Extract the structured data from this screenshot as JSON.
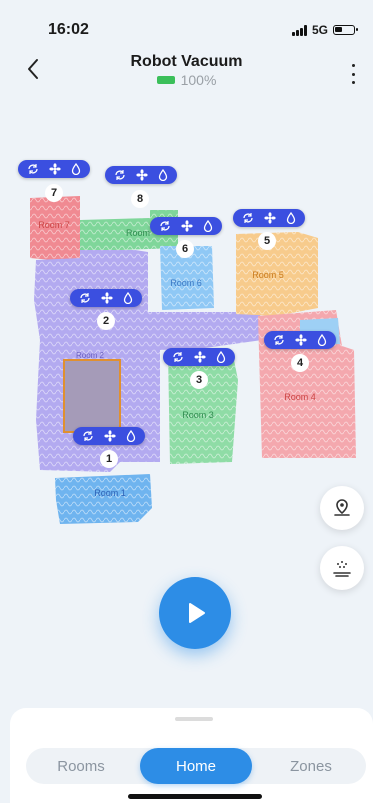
{
  "status_bar": {
    "time": "16:02",
    "network": "5G"
  },
  "header": {
    "title": "Robot Vacuum",
    "battery": "100%"
  },
  "colors": {
    "accent": "#2d8de6",
    "chip": "#3b4fe0",
    "battery_green": "#3bbf5a"
  },
  "rooms": [
    {
      "number": "1",
      "label": "Room 1"
    },
    {
      "number": "2",
      "label": "Room 2"
    },
    {
      "number": "3",
      "label": "Room 3"
    },
    {
      "number": "4",
      "label": "Room 4"
    },
    {
      "number": "5",
      "label": "Room 5"
    },
    {
      "number": "6",
      "label": "Room 6"
    },
    {
      "number": "7",
      "label": "Room 7"
    },
    {
      "number": "8",
      "label": "Room"
    }
  ],
  "room_chip_icons": [
    "cycle-icon",
    "fan-icon",
    "water-drop-icon"
  ],
  "side_buttons": [
    "location-pin-icon",
    "dock-icon"
  ],
  "tabs": {
    "rooms": "Rooms",
    "home": "Home",
    "zones": "Zones",
    "active": "home"
  }
}
